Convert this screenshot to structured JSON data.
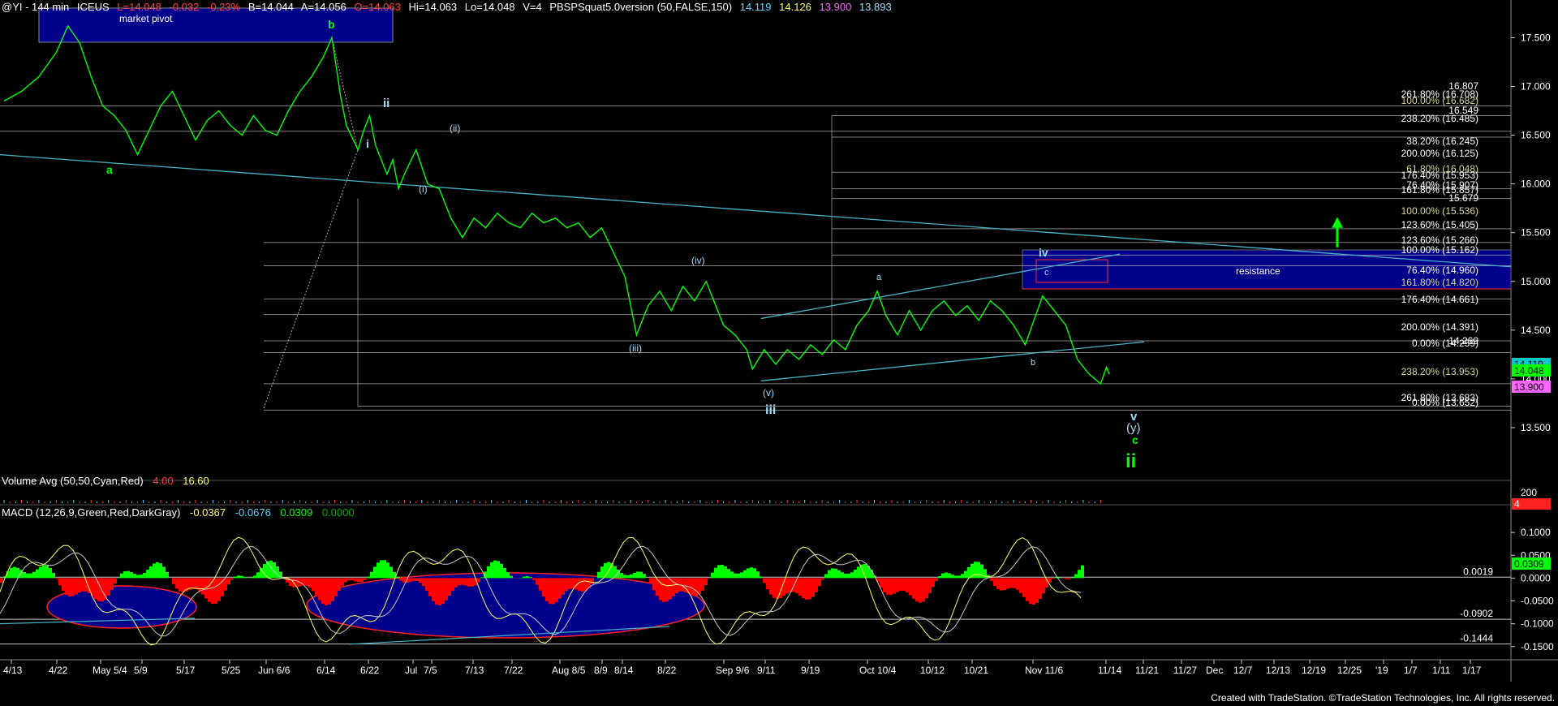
{
  "header": {
    "symbol": "@YI - 144 min",
    "exchange": "ICEUS",
    "last": "L=14.048",
    "change": "-0.032",
    "change_pct": "-0.23%",
    "bid": "B=14.044",
    "ask": "A=14.056",
    "open": "O=14.063",
    "high": "Hi=14.063",
    "low": "Lo=14.048",
    "vol": "V=4",
    "study": "PBSPSquat5.0version (50,FALSE,150)",
    "study_values": [
      "14.119",
      "14.126",
      "13.900",
      "13.893"
    ],
    "study_colors": [
      "#5fd7ff",
      "#ffff66",
      "#ff66ff",
      "#9adfff"
    ]
  },
  "volume_panel": {
    "label": "Volume Avg (50,50,Cyan,Red)",
    "v1": "4.00",
    "v2": "16.60",
    "axis": [
      "200",
      "4"
    ]
  },
  "macd_panel": {
    "label": "MACD (12,26,9,Green,Red,DarkGray)",
    "values": [
      "-0.0367",
      "-0.0676",
      "0.0309",
      "0.0000"
    ],
    "value_colors": [
      "#ffff66",
      "#5fd7ff",
      "#00ff00",
      "#00aa00"
    ],
    "level_labels": [
      "0.0019",
      "-0.0902",
      "-0.1444"
    ],
    "current_tag": "0.0309"
  },
  "price_tags": [
    "14.119",
    "14.048",
    "13.900"
  ],
  "annotations": {
    "market_pivot": "market pivot",
    "resistance": "resistance",
    "waves": [
      "a",
      "b",
      "i",
      "ii",
      "(i)",
      "(ii)",
      "(iii)",
      "(iv)",
      "(v)",
      "iii",
      "iv",
      "a",
      "b",
      "c",
      "v",
      "(y)",
      "c",
      "ii"
    ]
  },
  "fib_labels": [
    "16.807",
    "261.80% (16.708)",
    "100.00% (16.682)",
    "16.549",
    "238.20% (16.485)",
    "38.20% (16.245)",
    "200.00% (16.125)",
    "61.80% (16.048)",
    "176.40% (15.953)",
    "76.40% (15.907)",
    "161.80% (15.857)",
    "15.679",
    "100.00% (15.536)",
    "123.60% (15.405)",
    "123.60% (15.266)",
    "100.00% (15.162)",
    "76.40% (14.960)",
    "161.80% (14.820)",
    "176.40% (14.661)",
    "200.00% (14.391)",
    "0.00% (14.259)",
    "14.269",
    "238.20% (13.953)",
    "261.80% (13.683)",
    "0.00% (13.652)"
  ],
  "footer": "Created with TradeStation. ©TradeStation Technologies, Inc. All rights reserved.",
  "colors": {
    "price": "#00ff00",
    "background": "#000000",
    "axis_text": "#ffffff",
    "trendline": "#46b4c8",
    "fib_line": "#c8c8c8",
    "pivot_box": "#00008b",
    "resistance_border": "#ff3030",
    "macd_hist_pos": "#00ff00",
    "macd_hist_neg": "#ff0000"
  },
  "chart_data": {
    "type": "line",
    "title": "@YI - 144 min",
    "x_tick_labels": [
      "4/13",
      "4/22",
      "May 5/4",
      "5/9",
      "5/17",
      "5/25",
      "Jun 6/6",
      "6/14",
      "6/22",
      "Jul",
      "7/5",
      "7/13",
      "7/22",
      "Aug 8/5",
      "8/9",
      "8/14",
      "8/22",
      "Sep 9/6",
      "9/11",
      "9/19",
      "Oct 10/4",
      "10/12",
      "10/21",
      "Nov 11/6",
      "11/14",
      "11/21",
      "11/27",
      "Dec",
      "12/7",
      "12/13",
      "12/19",
      "12/25",
      "'19",
      "1/7",
      "1/11",
      "1/17"
    ],
    "y_ticks": [
      13.5,
      14.0,
      14.5,
      15.0,
      15.5,
      16.0,
      16.5,
      17.0,
      17.5
    ],
    "y_tick_labels": [
      "13.500",
      "14.000",
      "14.500",
      "15.000",
      "15.500",
      "16.000",
      "16.500",
      "17.000",
      "17.500"
    ],
    "ylim": [
      13.35,
      17.72
    ],
    "series": [
      {
        "values": [
          [
            0,
            16.85
          ],
          [
            3,
            16.95
          ],
          [
            6,
            17.1
          ],
          [
            9,
            17.35
          ],
          [
            11,
            17.62
          ],
          [
            13,
            17.45
          ],
          [
            15,
            17.1
          ],
          [
            17,
            16.8
          ],
          [
            19,
            16.7
          ],
          [
            21,
            16.55
          ],
          [
            23,
            16.3
          ],
          [
            25,
            16.55
          ],
          [
            27,
            16.8
          ],
          [
            29,
            16.95
          ],
          [
            31,
            16.7
          ],
          [
            33,
            16.45
          ],
          [
            35,
            16.65
          ],
          [
            37,
            16.75
          ],
          [
            39,
            16.6
          ],
          [
            41,
            16.5
          ],
          [
            43,
            16.7
          ],
          [
            45,
            16.55
          ],
          [
            47,
            16.5
          ],
          [
            49,
            16.75
          ],
          [
            51,
            16.95
          ],
          [
            53,
            17.1
          ],
          [
            55,
            17.3
          ],
          [
            56.5,
            17.5
          ],
          [
            58,
            16.9
          ],
          [
            59,
            16.6
          ],
          [
            61,
            16.35
          ],
          [
            62,
            16.55
          ],
          [
            63,
            16.7
          ],
          [
            64,
            16.4
          ],
          [
            66,
            16.1
          ],
          [
            67,
            16.25
          ],
          [
            68,
            15.95
          ],
          [
            69,
            16.1
          ],
          [
            71,
            16.35
          ],
          [
            73,
            16.0
          ],
          [
            75,
            15.95
          ],
          [
            77,
            15.65
          ],
          [
            79,
            15.45
          ],
          [
            81,
            15.65
          ],
          [
            83,
            15.55
          ],
          [
            85,
            15.7
          ],
          [
            87,
            15.6
          ],
          [
            89,
            15.55
          ],
          [
            91,
            15.7
          ],
          [
            93,
            15.6
          ],
          [
            95,
            15.65
          ],
          [
            97,
            15.55
          ],
          [
            99,
            15.6
          ],
          [
            101,
            15.45
          ],
          [
            103,
            15.55
          ],
          [
            105,
            15.3
          ],
          [
            107,
            15.05
          ],
          [
            109,
            14.45
          ],
          [
            111,
            14.75
          ],
          [
            113,
            14.9
          ],
          [
            115,
            14.7
          ],
          [
            117,
            14.95
          ],
          [
            119,
            14.8
          ],
          [
            121,
            15.0
          ],
          [
            122,
            14.85
          ],
          [
            124,
            14.55
          ],
          [
            126,
            14.45
          ],
          [
            128,
            14.3
          ],
          [
            129,
            14.1
          ],
          [
            131,
            14.3
          ],
          [
            133,
            14.15
          ],
          [
            135,
            14.3
          ],
          [
            137,
            14.2
          ],
          [
            139,
            14.35
          ],
          [
            141,
            14.25
          ],
          [
            143,
            14.4
          ],
          [
            145,
            14.3
          ],
          [
            147,
            14.55
          ],
          [
            149,
            14.7
          ],
          [
            150.5,
            14.9
          ],
          [
            152,
            14.65
          ],
          [
            154,
            14.45
          ],
          [
            156,
            14.7
          ],
          [
            158,
            14.5
          ],
          [
            160,
            14.7
          ],
          [
            162,
            14.8
          ],
          [
            164,
            14.65
          ],
          [
            166,
            14.75
          ],
          [
            168,
            14.6
          ],
          [
            170,
            14.8
          ],
          [
            172,
            14.7
          ],
          [
            174,
            14.55
          ],
          [
            176,
            14.35
          ],
          [
            177.5,
            14.6
          ],
          [
            179,
            14.85
          ],
          [
            181,
            14.7
          ],
          [
            183,
            14.55
          ],
          [
            185,
            14.2
          ],
          [
            187,
            14.05
          ],
          [
            189,
            13.95
          ],
          [
            190,
            14.12
          ],
          [
            190.5,
            14.048
          ]
        ]
      }
    ],
    "macd_ylim": [
      -0.17,
      0.15
    ],
    "macd_ticks": [
      0.1,
      0.05,
      0.0,
      -0.05,
      -0.1,
      -0.15
    ],
    "macd_tick_labels": [
      "0.1000",
      "0.0500",
      "0.0000",
      "-0.0500",
      "-0.1000",
      "-0.1500"
    ]
  }
}
